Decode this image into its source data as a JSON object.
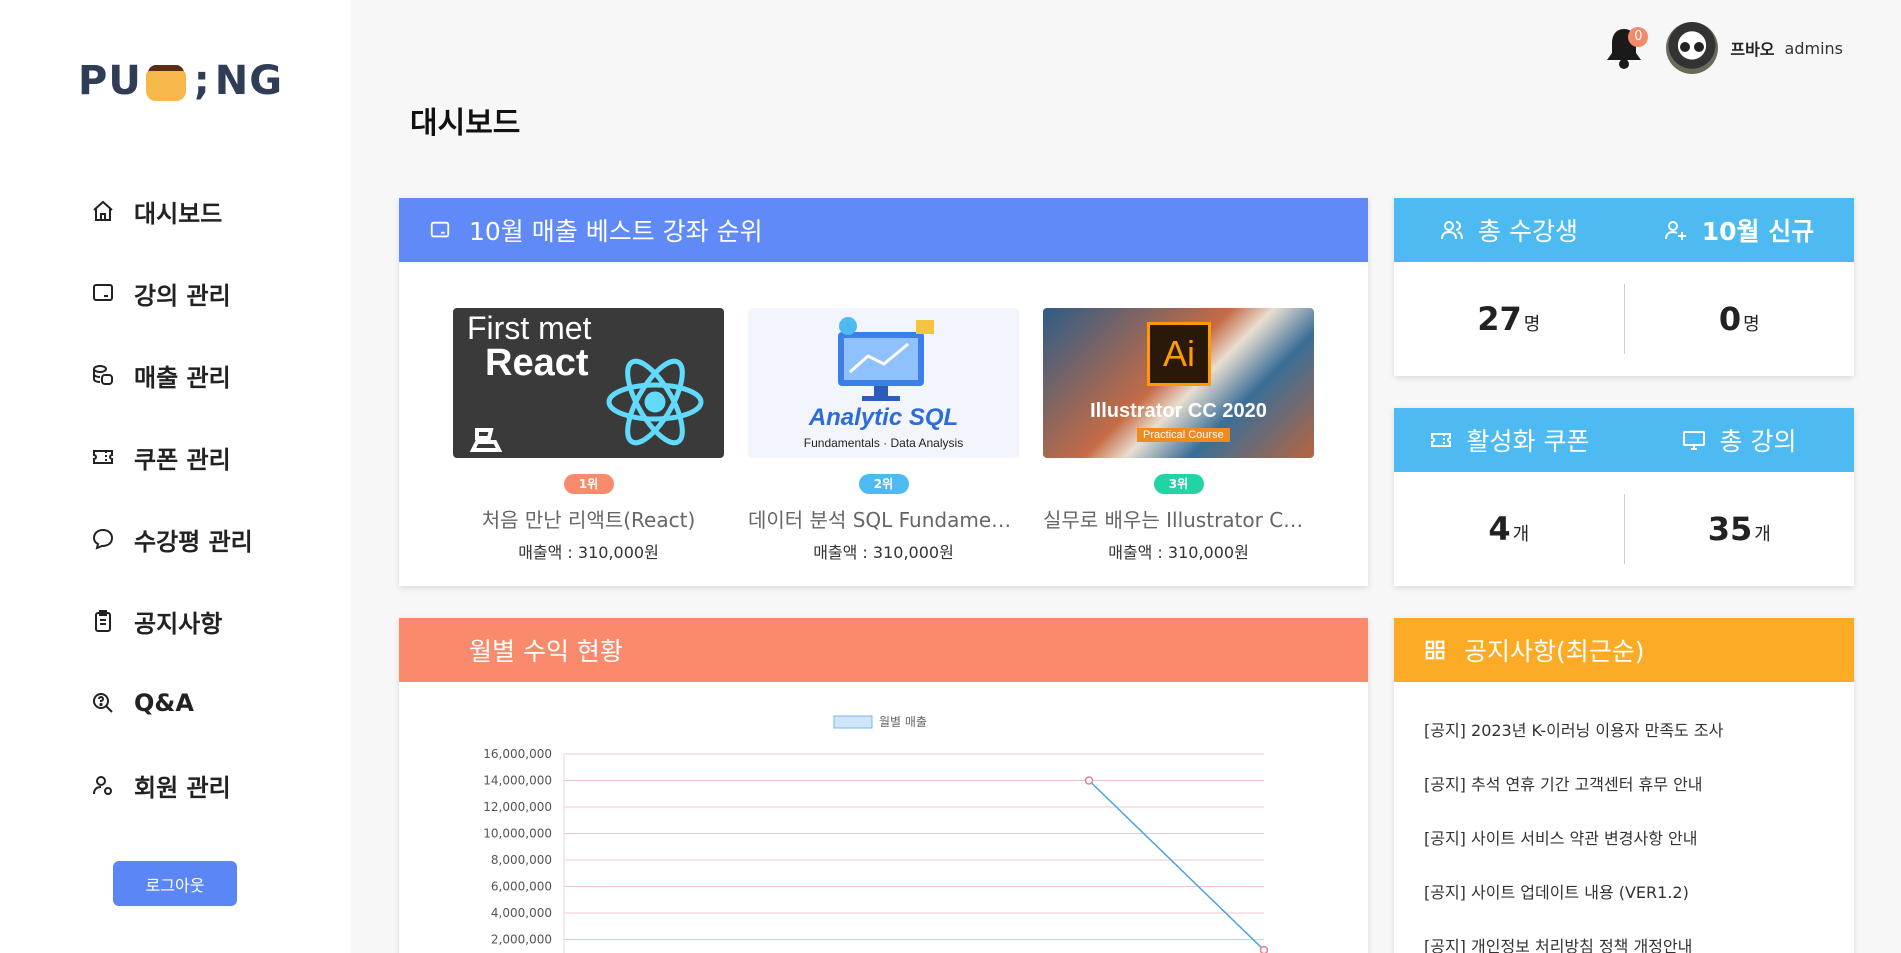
{
  "brand": {
    "logo_left": "PU",
    "logo_right": "NG"
  },
  "sidebar": {
    "items": [
      {
        "label": "대시보드",
        "icon": "home-icon"
      },
      {
        "label": "강의 관리",
        "icon": "monitor-icon"
      },
      {
        "label": "매출 관리",
        "icon": "coins-icon"
      },
      {
        "label": "쿠폰 관리",
        "icon": "ticket-icon"
      },
      {
        "label": "수강평 관리",
        "icon": "chat-bubble-icon"
      },
      {
        "label": "공지사항",
        "icon": "clipboard-icon"
      },
      {
        "label": "Q&A",
        "icon": "search-question-icon"
      },
      {
        "label": "회원 관리",
        "icon": "user-settings-icon"
      }
    ],
    "logout_label": "로그아웃"
  },
  "header": {
    "notification_count": "0",
    "user_name": "프바오",
    "user_role": "admins"
  },
  "page_title": "대시보드",
  "best_courses": {
    "title": "10월 매출 베스트 강좌 순위",
    "items": [
      {
        "rank": "1위",
        "title": "처음 만난 리액트(React)",
        "sales": "매출액 : 310,000원",
        "thumb_line1": "First met",
        "thumb_line2": "React",
        "rank_color": "#f98a6c"
      },
      {
        "rank": "2위",
        "title": "데이터 분석 SQL Fundamen...",
        "sales": "매출액 : 310,000원",
        "thumb_line1": "Analytic SQL",
        "thumb_line2": "Fundamentals · Data Analysis",
        "rank_color": "#4dbbf2"
      },
      {
        "rank": "3위",
        "title": "실무로 배우는 Illustrator CC...",
        "sales": "매출액 : 310,000원",
        "thumb_line1": "Illustrator CC 2020",
        "thumb_line2": "Practical Course",
        "thumb_logo": "Ai",
        "rank_color": "#22d3a5"
      }
    ]
  },
  "stats_students": {
    "left_label": "총 수강생",
    "right_label": "10월 신규",
    "left_value": "27",
    "left_unit": "명",
    "right_value": "0",
    "right_unit": "명"
  },
  "stats_coupons": {
    "left_label": "활성화 쿠폰",
    "right_label": "총 강의",
    "left_value": "4",
    "left_unit": "개",
    "right_value": "35",
    "right_unit": "개"
  },
  "revenue": {
    "title": "월별 수익 현황"
  },
  "notices": {
    "title": "공지사항(최근순)",
    "items": [
      "[공지] 2023년 K-이러닝 이용자 만족도 조사",
      "[공지] 추석 연휴 기간 고객센터 휴무 안내",
      "[공지] 사이트 서비스 약관 변경사항 안내",
      "[공지] 사이트 업데이트 내용 (VER1.2)",
      "[공지] 개인정보 처리방침 정책 개정안내"
    ]
  },
  "chart_data": {
    "type": "line",
    "legend": "월별 매출",
    "y_ticks": [
      "16,000,000",
      "14,000,000",
      "12,000,000",
      "10,000,000",
      "8,000,000",
      "6,000,000",
      "4,000,000",
      "2,000,000"
    ],
    "ylim": [
      0,
      16000000
    ],
    "series": [
      {
        "name": "월별 매출",
        "points": [
          {
            "x": 0.75,
            "y": 14000000
          },
          {
            "x": 1.0,
            "y": 1200000
          }
        ]
      }
    ],
    "grid": true,
    "line_color": "#4da3e0",
    "point_color": "#f07a90"
  }
}
